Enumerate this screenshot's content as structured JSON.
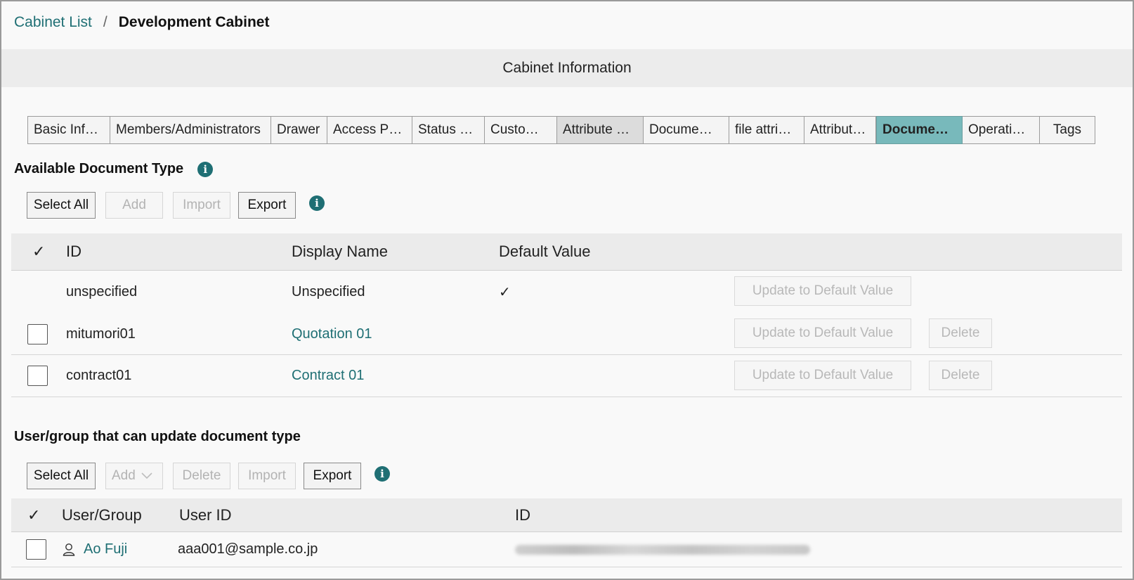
{
  "breadcrumb": {
    "parent": "Cabinet List",
    "separator": "/",
    "current": "Development Cabinet"
  },
  "band": {
    "title": "Cabinet Information"
  },
  "tabs": [
    {
      "label": "Basic Inf…"
    },
    {
      "label": "Members/Administrators"
    },
    {
      "label": "Drawer"
    },
    {
      "label": "Access P…"
    },
    {
      "label": "Status …"
    },
    {
      "label": "Custo…"
    },
    {
      "label": "Attribute …"
    },
    {
      "label": "Docume…"
    },
    {
      "label": "file attri…"
    },
    {
      "label": "Attribut…"
    },
    {
      "label": "Docume…"
    },
    {
      "label": "Operati…"
    },
    {
      "label": "Tags"
    }
  ],
  "doc_types": {
    "title": "Available Document Type",
    "info_icon": "i",
    "toolbar": {
      "select_all": "Select All",
      "add": "Add",
      "import": "Import",
      "export": "Export"
    },
    "headers": {
      "check": "✓",
      "id": "ID",
      "display_name": "Display Name",
      "default_value": "Default Value"
    },
    "rows": [
      {
        "id": "unspecified",
        "display_name": "Unspecified",
        "is_default": "✓",
        "update_label": "Update to Default Value"
      },
      {
        "id": "mitumori01",
        "display_name": "Quotation 01",
        "update_label": "Update to Default Value",
        "delete_label": "Delete"
      },
      {
        "id": "contract01",
        "display_name": "Contract 01",
        "update_label": "Update to Default Value",
        "delete_label": "Delete"
      }
    ]
  },
  "updaters": {
    "title": "User/group that can update document type",
    "info_icon": "i",
    "toolbar": {
      "select_all": "Select All",
      "add": "Add",
      "delete": "Delete",
      "import": "Import",
      "export": "Export"
    },
    "headers": {
      "check": "✓",
      "user_group": "User/Group",
      "user_id": "User ID",
      "id": "ID"
    },
    "rows": [
      {
        "name": "Ao Fuji",
        "user_id": "aaa001@sample.co.jp"
      }
    ]
  },
  "colors": {
    "accent": "#1f6f74",
    "active_tab": "#78b9bb",
    "header_band": "#ececec"
  }
}
